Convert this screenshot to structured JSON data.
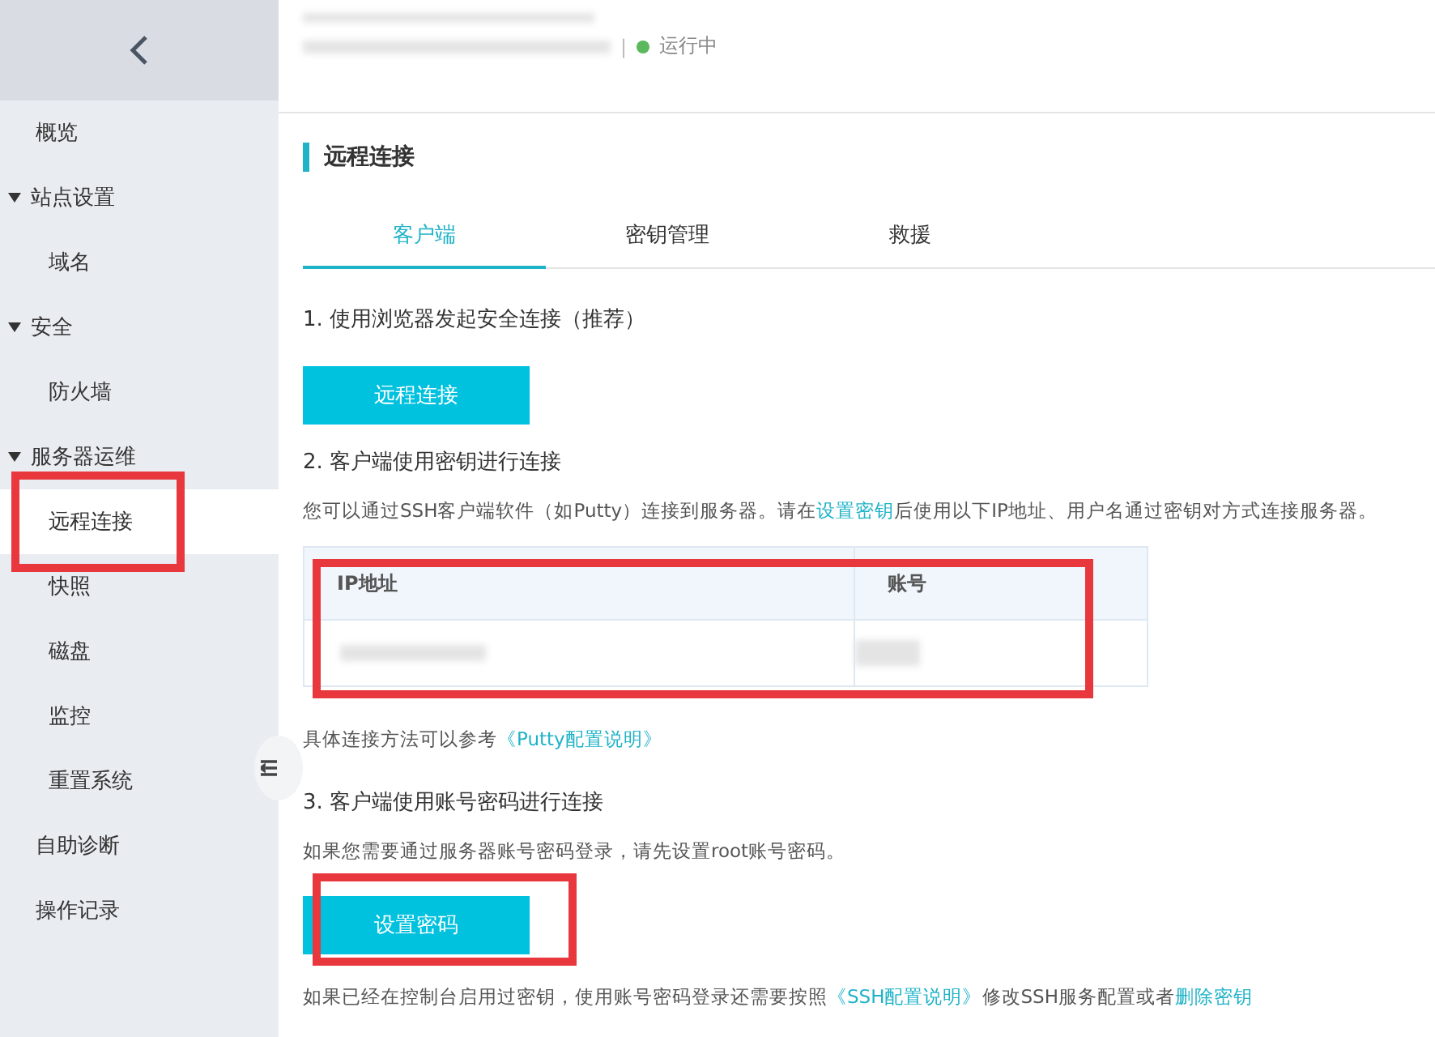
{
  "header": {
    "separator": "|",
    "status": {
      "text": "运行中",
      "color": "#5cb85c"
    }
  },
  "sidebar": {
    "items": [
      {
        "label": "概览",
        "selected": false
      },
      {
        "label": "站点设置",
        "expanded": true,
        "children": [
          {
            "label": "域名",
            "selected": false
          }
        ]
      },
      {
        "label": "安全",
        "expanded": true,
        "children": [
          {
            "label": "防火墙",
            "selected": false
          }
        ]
      },
      {
        "label": "服务器运维",
        "expanded": true,
        "children": [
          {
            "label": "远程连接",
            "selected": true
          },
          {
            "label": "快照",
            "selected": false
          },
          {
            "label": "磁盘",
            "selected": false
          },
          {
            "label": "监控",
            "selected": false
          },
          {
            "label": "重置系统",
            "selected": false
          }
        ]
      },
      {
        "label": "自助诊断",
        "selected": false
      },
      {
        "label": "操作记录",
        "selected": false
      }
    ]
  },
  "section_title": "远程连接",
  "tabs": [
    {
      "label": "客户端",
      "selected": true
    },
    {
      "label": "密钥管理",
      "selected": false
    },
    {
      "label": "救援",
      "selected": false
    }
  ],
  "steps": [
    {
      "kind": "button",
      "heading": "1. 使用浏览器发起安全连接（推荐）",
      "button": "远程连接"
    },
    {
      "kind": "table",
      "heading": "2. 客户端使用密钥进行连接",
      "intro": [
        {
          "text": "您可以通过SSH客户端软件（如Putty）连接到服务器。请在"
        },
        {
          "link": "设置密钥"
        },
        {
          "text": "后使用以下IP地址、用户名通过密钥对方式连接服务器。"
        }
      ],
      "columns": [
        "IP地址",
        "账号"
      ],
      "note": [
        {
          "text": "具体连接方法可以参考"
        },
        {
          "link": "《Putty配置说明》"
        }
      ]
    },
    {
      "kind": "password",
      "heading": "3. 客户端使用账号密码进行连接",
      "intro": [
        {
          "text": "如果您需要通过服务器账号密码登录，请先设置root账号密码。"
        }
      ],
      "button": "设置密码",
      "note": [
        {
          "text": "如果已经在控制台启用过密钥，使用账号密码登录还需要按照"
        },
        {
          "link": "《SSH配置说明》"
        },
        {
          "text": "修改SSH服务配置或者"
        },
        {
          "link": "删除密钥"
        }
      ]
    }
  ]
}
